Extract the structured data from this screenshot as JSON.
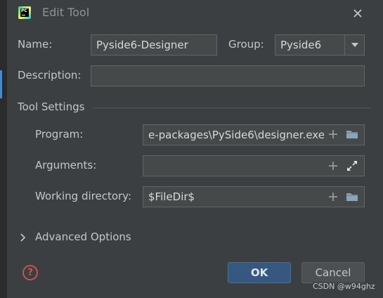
{
  "window": {
    "title": "Edit Tool",
    "app_logo_text": "PC"
  },
  "form": {
    "name_label": "Name:",
    "name_value": "Pyside6-Designer",
    "group_label": "Group:",
    "group_value": "Pyside6",
    "description_label": "Description:",
    "description_value": ""
  },
  "tool_settings": {
    "section_title": "Tool Settings",
    "program_label": "Program:",
    "program_value": "e-packages\\PySide6\\designer.exe",
    "arguments_label": "Arguments:",
    "arguments_value": "",
    "working_dir_label": "Working directory:",
    "working_dir_value": "$FileDir$"
  },
  "advanced": {
    "label": "Advanced Options"
  },
  "buttons": {
    "help": "?",
    "ok": "OK",
    "cancel": "Cancel"
  },
  "watermark": "CSDN @w94ghz",
  "icons": {
    "close": "close-icon",
    "dropdown": "chevron-down-icon",
    "add": "plus-icon",
    "browse": "folder-icon",
    "expand": "expand-icon",
    "chevron_right": "chevron-right-icon"
  },
  "colors": {
    "accent": "#365880",
    "help": "#c75450",
    "field_bg": "#45494a",
    "dialog_bg": "#3c3f41"
  }
}
